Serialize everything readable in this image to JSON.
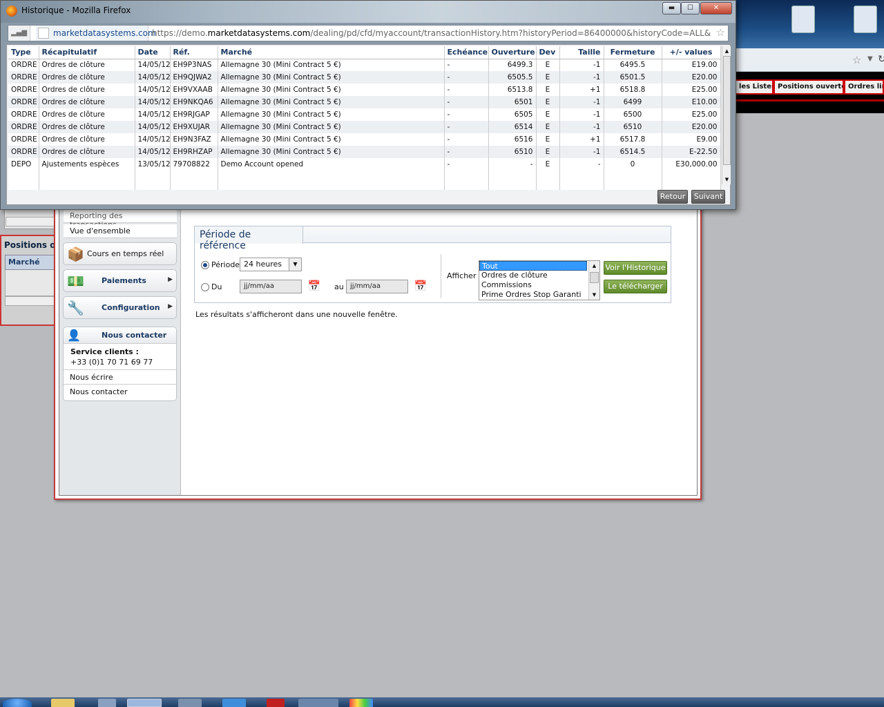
{
  "popup": {
    "title": "Historique - Mozilla Firefox",
    "window_controls": {
      "minimize": "▬",
      "maximize": "☐",
      "close": "✕"
    },
    "url": {
      "domain": "marketdatasystems.com",
      "prefix": "https://demo.",
      "host": "marketdatasystems.com",
      "path": "/dealing/pd/cfd/myaccount/transactionHistory.htm?historyPeriod=86400000&historyCode=ALL&historyDateFrom"
    },
    "table": {
      "columns": [
        "Type",
        "Récapitulatif",
        "Date",
        "Réf.",
        "Marché",
        "Echéance",
        "Ouverture",
        "Dev",
        "Taille",
        "Fermeture",
        "+/- values"
      ],
      "rows": [
        [
          "ORDRE",
          "Ordres de clôture",
          "14/05/12",
          "EH9P3NAS",
          "Allemagne 30 (Mini Contract 5 €)",
          "-",
          "6499.3",
          "E",
          "-1",
          "6495.5",
          "E19.00"
        ],
        [
          "ORDRE",
          "Ordres de clôture",
          "14/05/12",
          "EH9QJWA2",
          "Allemagne 30 (Mini Contract 5 €)",
          "-",
          "6505.5",
          "E",
          "-1",
          "6501.5",
          "E20.00"
        ],
        [
          "ORDRE",
          "Ordres de clôture",
          "14/05/12",
          "EH9VXAAB",
          "Allemagne 30 (Mini Contract 5 €)",
          "-",
          "6513.8",
          "E",
          "+1",
          "6518.8",
          "E25.00"
        ],
        [
          "ORDRE",
          "Ordres de clôture",
          "14/05/12",
          "EH9NKQA6",
          "Allemagne 30 (Mini Contract 5 €)",
          "-",
          "6501",
          "E",
          "-1",
          "6499",
          "E10.00"
        ],
        [
          "ORDRE",
          "Ordres de clôture",
          "14/05/12",
          "EH9RJGAP",
          "Allemagne 30 (Mini Contract 5 €)",
          "-",
          "6505",
          "E",
          "-1",
          "6500",
          "E25.00"
        ],
        [
          "ORDRE",
          "Ordres de clôture",
          "14/05/12",
          "EH9XUJAR",
          "Allemagne 30 (Mini Contract 5 €)",
          "-",
          "6514",
          "E",
          "-1",
          "6510",
          "E20.00"
        ],
        [
          "ORDRE",
          "Ordres de clôture",
          "14/05/12",
          "EH9N3FAZ",
          "Allemagne 30 (Mini Contract 5 €)",
          "-",
          "6516",
          "E",
          "+1",
          "6517.8",
          "E9.00"
        ],
        [
          "ORDRE",
          "Ordres de clôture",
          "14/05/12",
          "EH9RHZAP",
          "Allemagne 30 (Mini Contract 5 €)",
          "-",
          "6510",
          "E",
          "-1",
          "6514.5",
          "E-22.50"
        ],
        [
          "DEPO",
          "Ajustements espèces",
          "13/05/12",
          "79708822",
          "Demo Account opened",
          "-",
          "-",
          "E",
          "-",
          "0",
          "E30,000.00"
        ]
      ]
    },
    "buttons": {
      "back": "Retour",
      "next": "Suivant"
    }
  },
  "background_tabs": {
    "lists": "les Listes",
    "open_positions": "Positions ouvertes",
    "limit_orders": "Ordres lim"
  },
  "left_panel": {
    "title": "Positions ou",
    "column": "Marché"
  },
  "sidebar": {
    "links": [
      "Reporting des transactions",
      "Vue d'ensemble"
    ],
    "realtime": "Cours en temps réel",
    "payments": "Paiements",
    "configuration": "Configuration",
    "contact": {
      "title": "Nous contacter",
      "service_label": "Service clients :",
      "phone": "+33 (0)1 70 71 69 77",
      "write": "Nous écrire",
      "contact": "Nous contacter"
    }
  },
  "period": {
    "title": "Période de référence",
    "period_label": "Période",
    "period_value": "24 heures",
    "from_label": "Du",
    "to_label": "au",
    "date_placeholder": "jj/mm/aa",
    "show_label": "Afficher",
    "show_options": [
      "Tout",
      "Ordres de clôture",
      "Commissions",
      "Prime Ordres Stop Garanti"
    ],
    "view_button": "Voir l'Historique",
    "download_button": "Le télécharger",
    "note": "Les résultats s'afficheront dans une nouvelle fenêtre."
  }
}
